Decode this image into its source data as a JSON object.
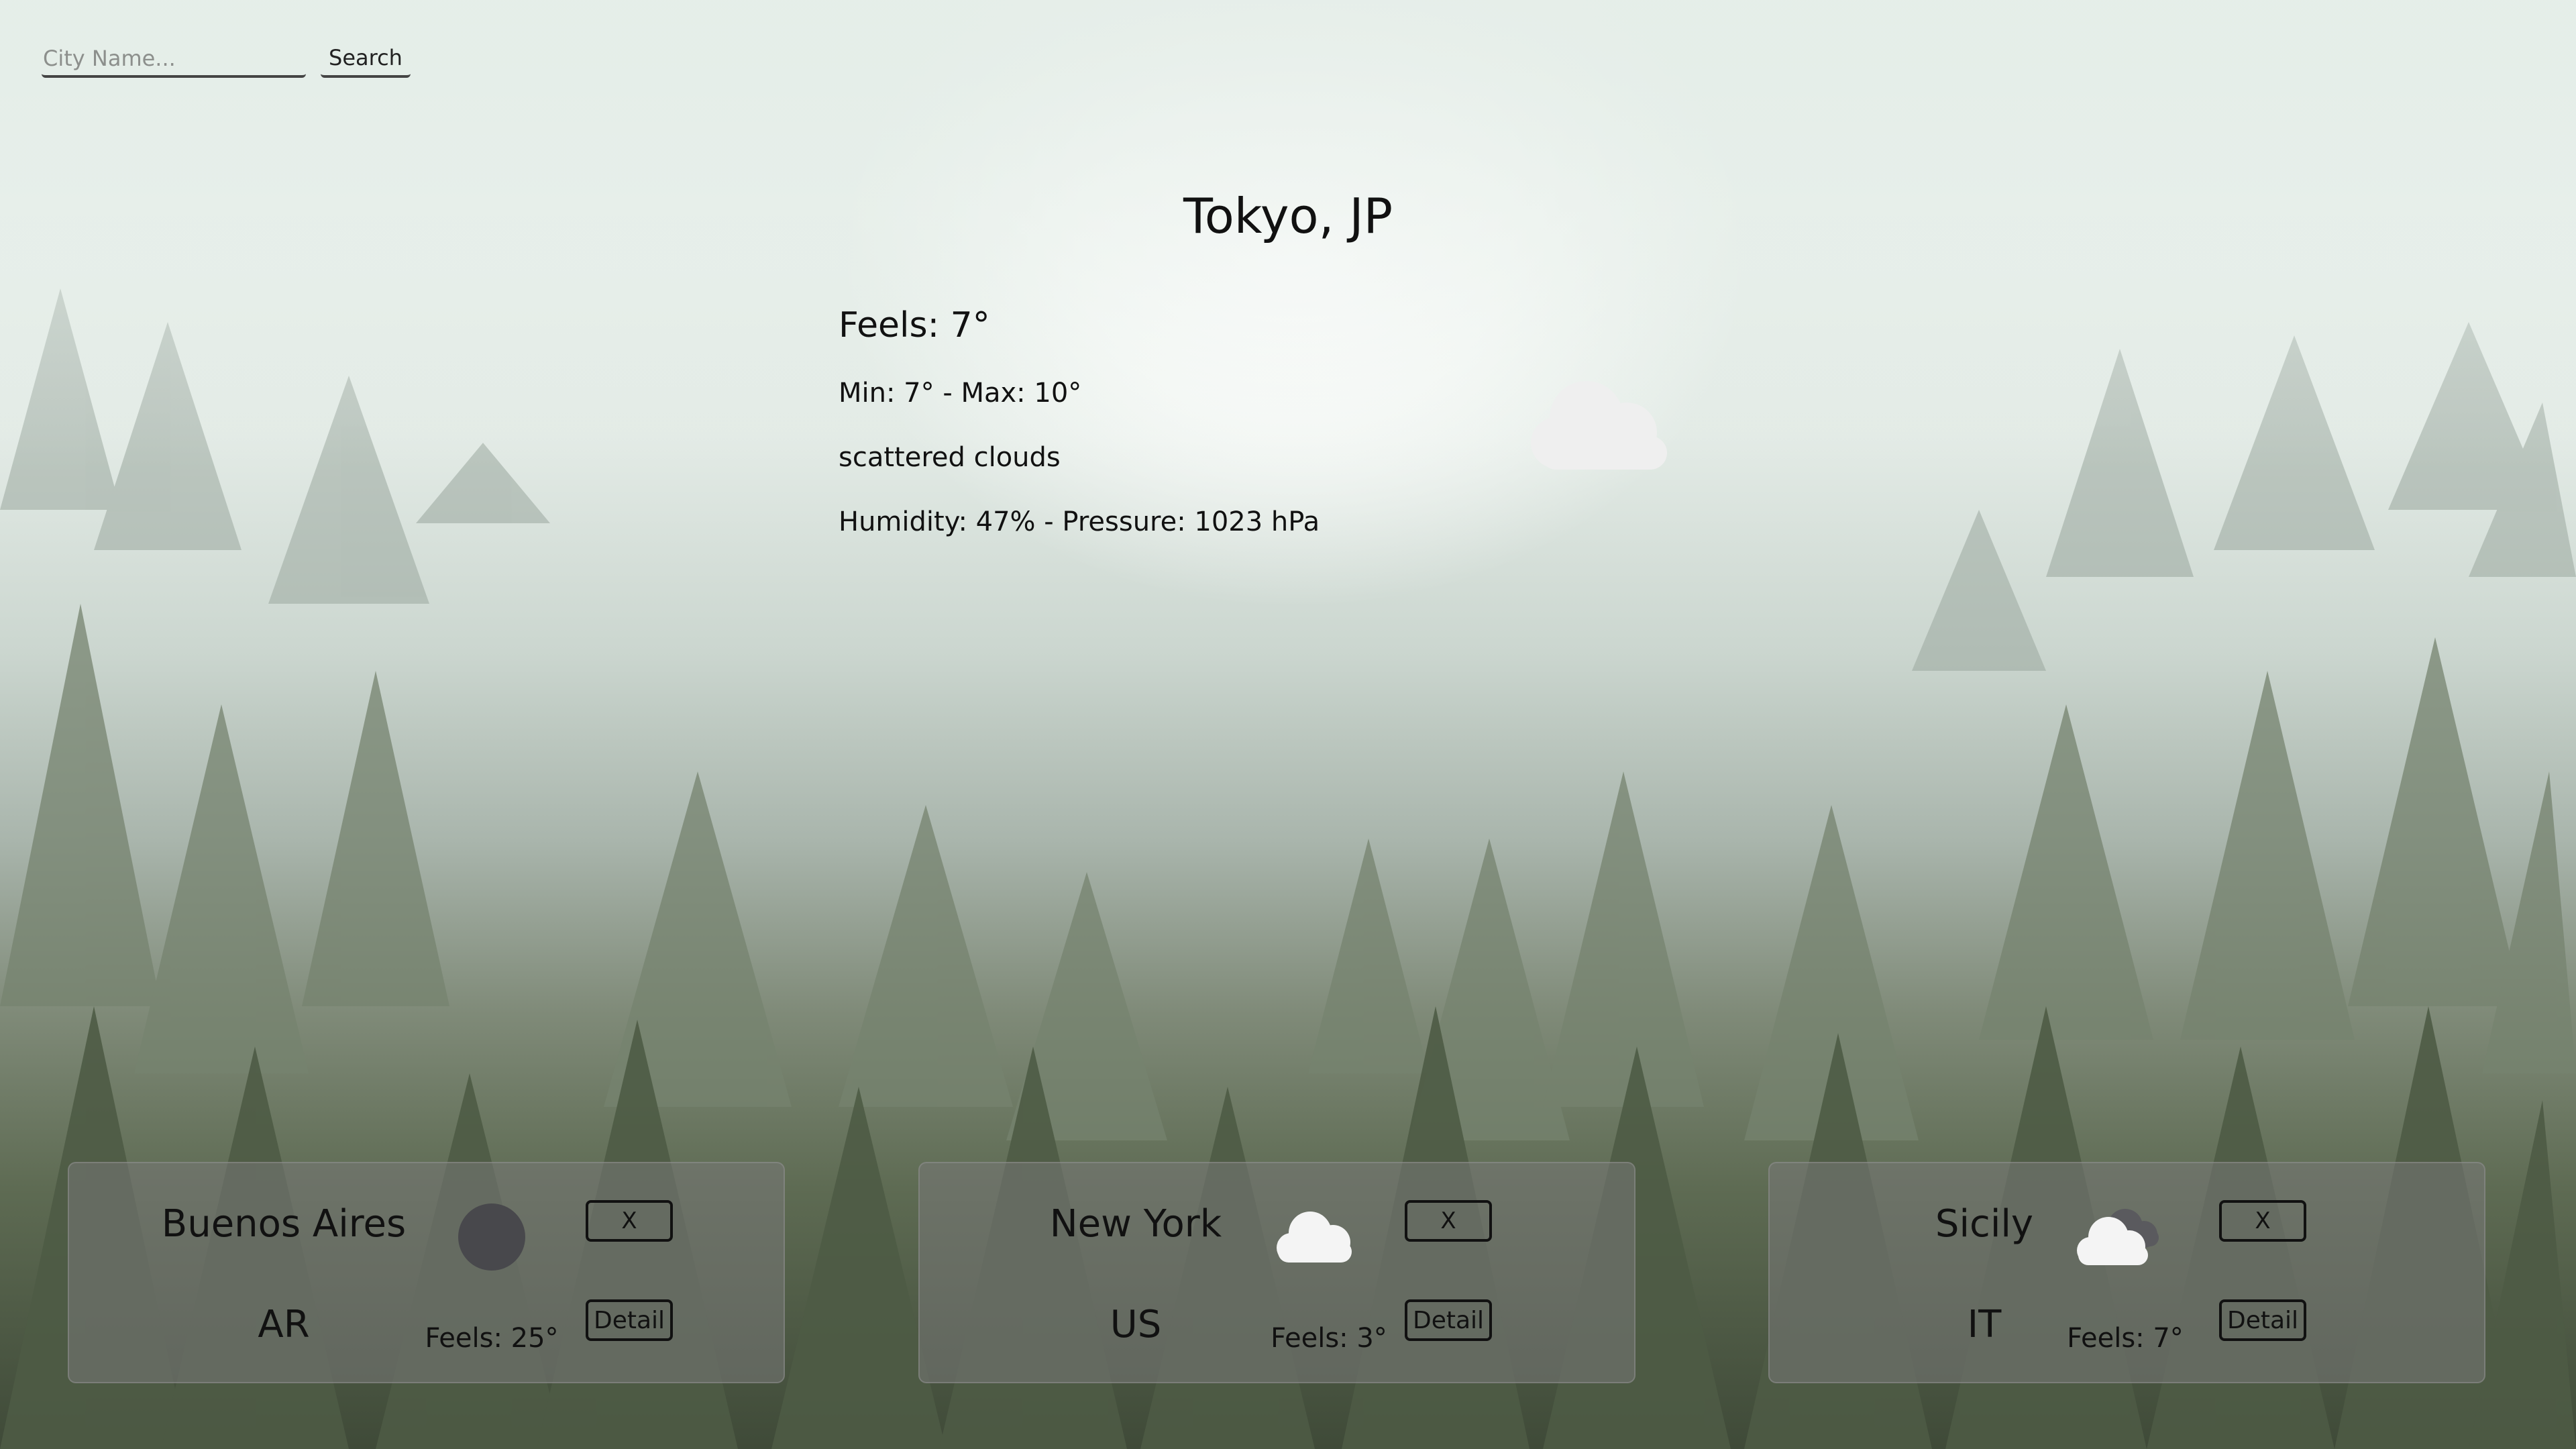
{
  "search": {
    "placeholder": "City Name...",
    "button_label": "Search"
  },
  "current": {
    "city": "Tokyo, JP",
    "feels": "Feels: 7°",
    "min_max": "Min: 7° - Max: 10°",
    "description": "scattered clouds",
    "humidity_pressure": "Humidity: 47% - Pressure: 1023 hPa",
    "icon": "cloud-icon"
  },
  "cards": [
    {
      "name": "Buenos Aires",
      "country": "AR",
      "feels": "Feels: 25°",
      "icon": "clear-night-icon",
      "close_label": "X",
      "detail_label": "Detail"
    },
    {
      "name": "New York",
      "country": "US",
      "feels": "Feels: 3°",
      "icon": "cloud-icon",
      "close_label": "X",
      "detail_label": "Detail"
    },
    {
      "name": "Sicily",
      "country": "IT",
      "feels": "Feels: 7°",
      "icon": "broken-clouds-icon",
      "close_label": "X",
      "detail_label": "Detail"
    }
  ],
  "colors": {
    "card_background": "#7a7a7a",
    "text": "#111111",
    "icon_white": "#f4f4f4",
    "icon_dark": "#4a4a4e"
  }
}
